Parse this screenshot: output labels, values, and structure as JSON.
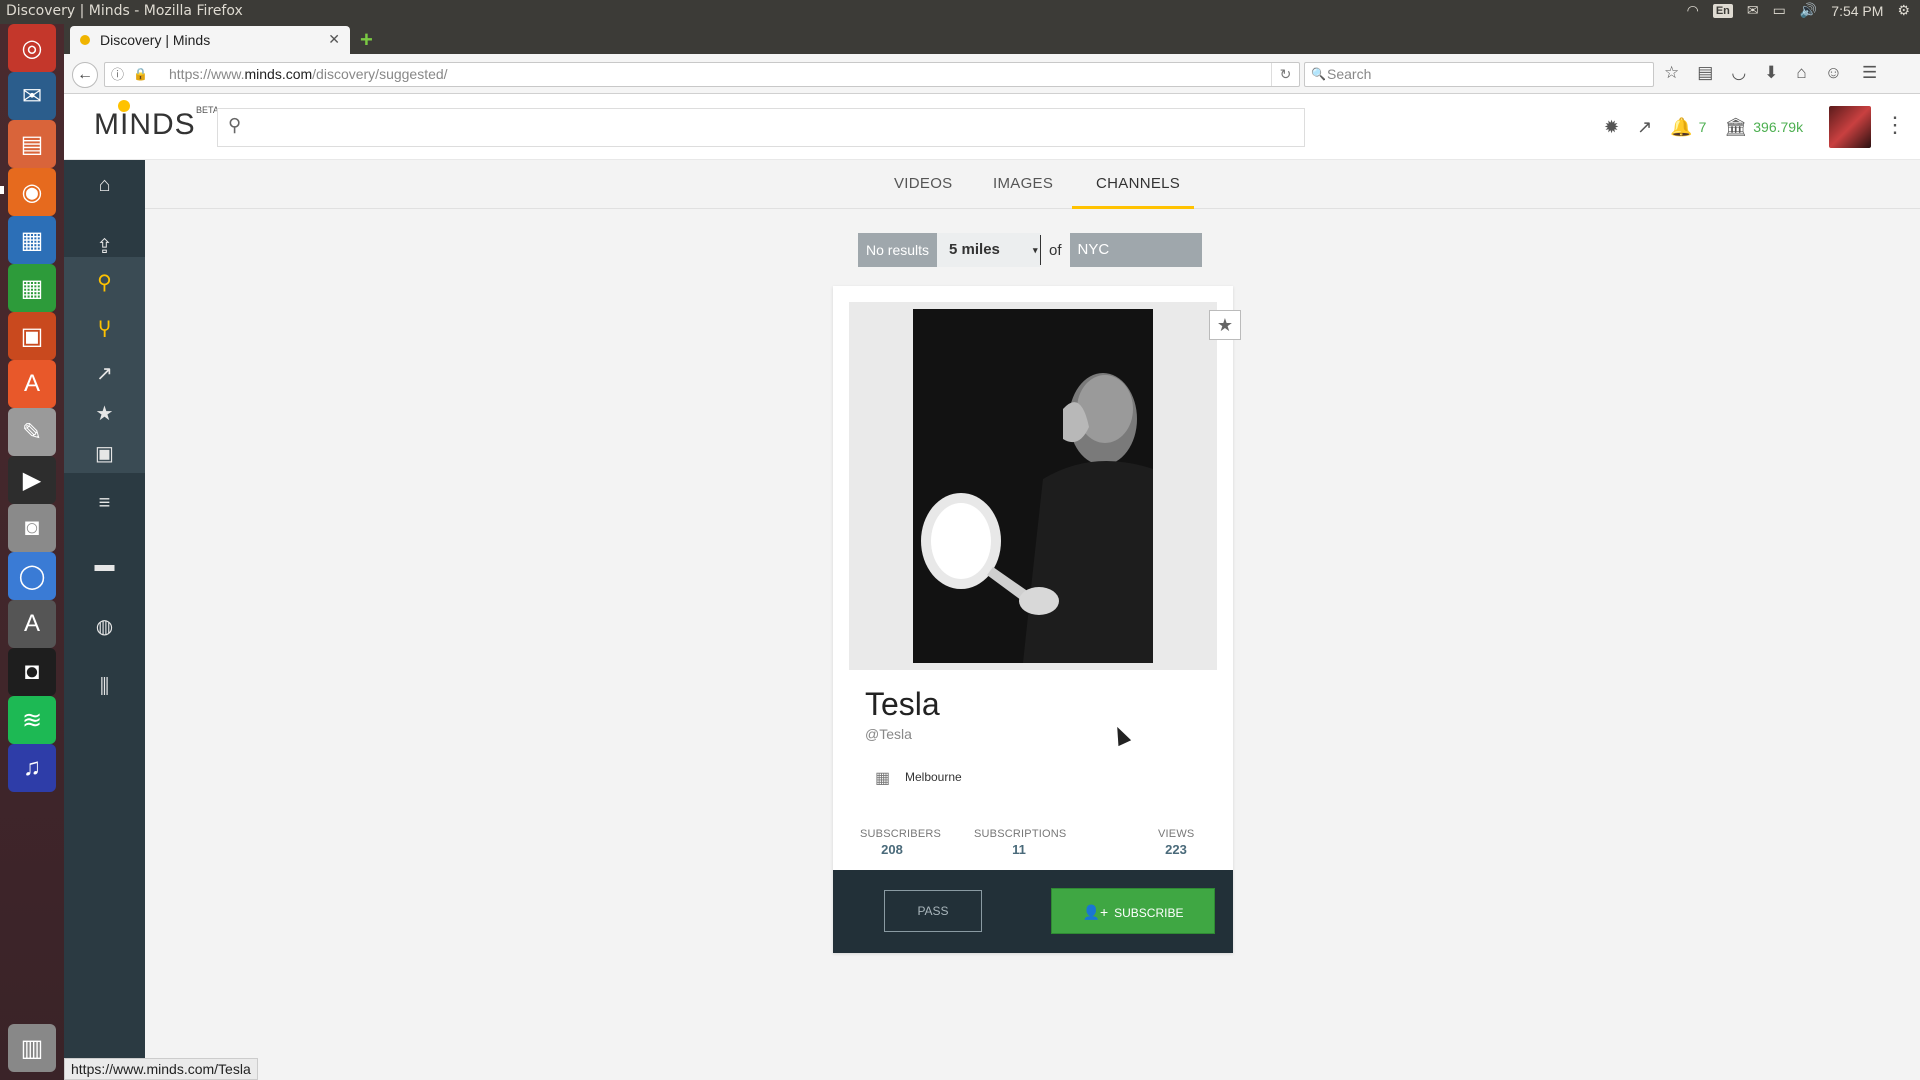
{
  "window_title": "Discovery | Minds - Mozilla Firefox",
  "system_tray": {
    "lang": "En",
    "time": "7:54 PM"
  },
  "browser": {
    "tab_title": "Discovery | Minds",
    "url_prefix": "https://www.",
    "url_host": "minds.com",
    "url_path": "/discovery/suggested/",
    "search_placeholder": "Search",
    "status_url": "https://www.minds.com/Tesla"
  },
  "header": {
    "logo": "MINDS",
    "beta": "BETA",
    "search_placeholder": "",
    "notification_count": "7",
    "wallet_balance": "396.79k"
  },
  "tabs": [
    "VIDEOS",
    "IMAGES",
    "CHANNELS"
  ],
  "active_tab": "CHANNELS",
  "filter": {
    "results_label": "No results",
    "distance": "5 miles",
    "of_label": "of",
    "city": "NYC"
  },
  "channel": {
    "name": "Tesla",
    "handle": "@Tesla",
    "location": "Melbourne",
    "stats": [
      {
        "label": "SUBSCRIBERS",
        "value": "208"
      },
      {
        "label": "SUBSCRIPTIONS",
        "value": "11"
      },
      {
        "label": "VIEWS",
        "value": "223"
      }
    ],
    "pass_label": "PASS",
    "subscribe_label": "SUBSCRIBE"
  },
  "colors": {
    "accent": "#ffc200",
    "sidebar": "#2b3a42",
    "subscribe": "#3fa743",
    "wallet": "#4caf50"
  }
}
